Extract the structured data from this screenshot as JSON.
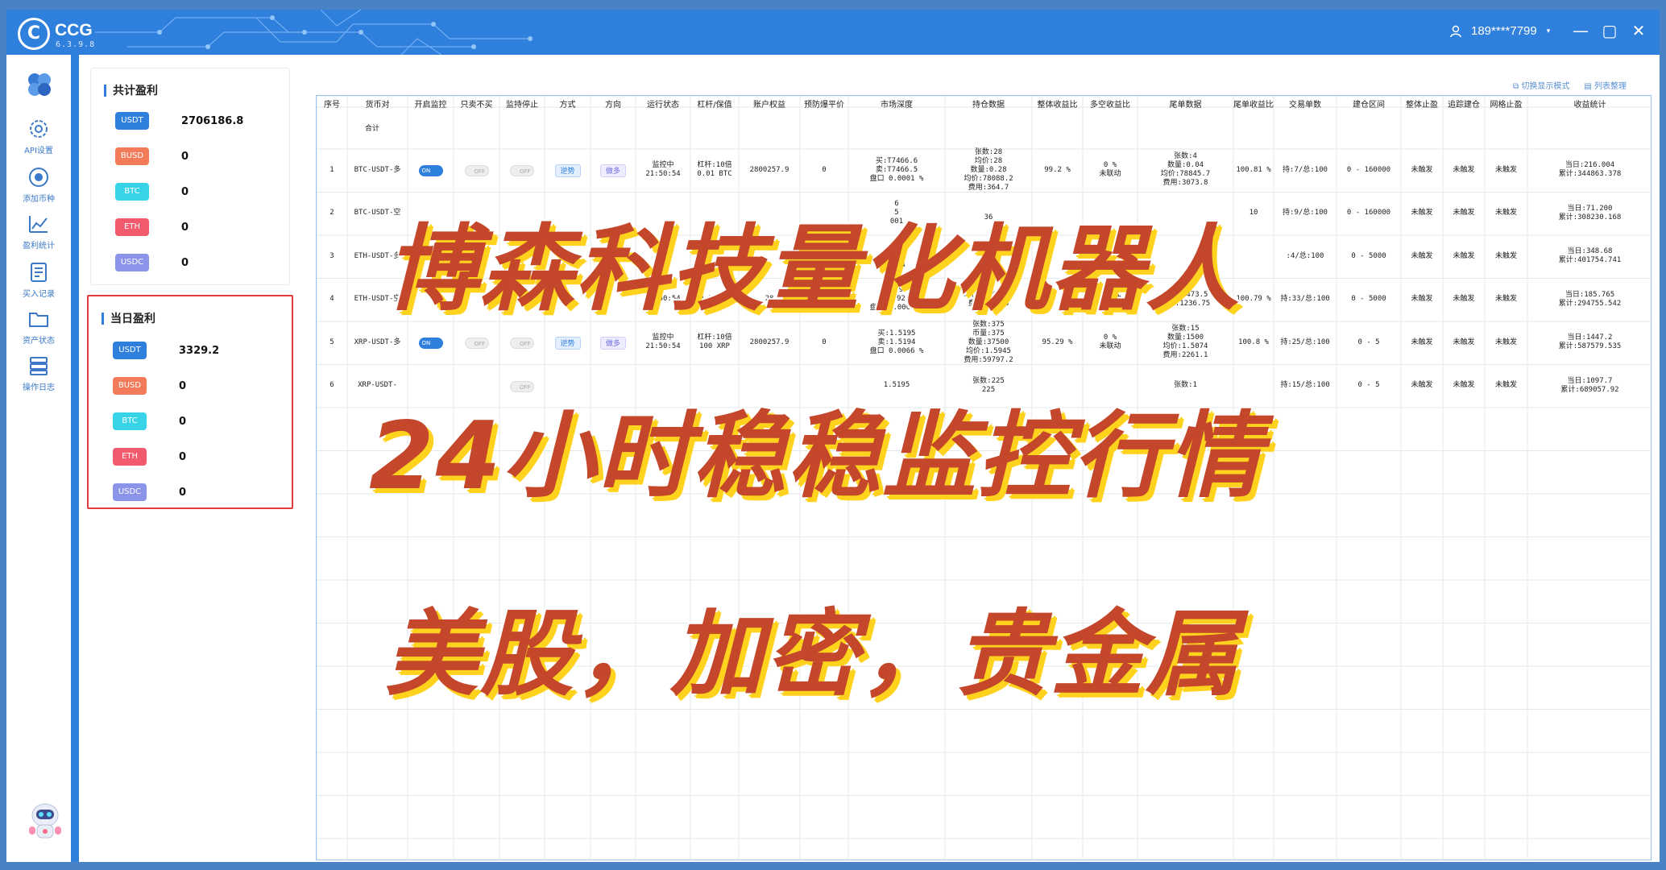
{
  "app": {
    "name": "CCG",
    "version": "6.3.9.8",
    "logo_letter": "C"
  },
  "user": {
    "phone": "189****7799"
  },
  "window_controls": {
    "minimize": "—",
    "restore": "▢",
    "close": "✕"
  },
  "sidebar": [
    {
      "label": "API设置",
      "icon": "gear-icon"
    },
    {
      "label": "添加币种",
      "icon": "target-icon"
    },
    {
      "label": "盈利统计",
      "icon": "chart-icon"
    },
    {
      "label": "买入记录",
      "icon": "receipt-icon"
    },
    {
      "label": "资产状态",
      "icon": "folder-icon"
    },
    {
      "label": "操作日志",
      "icon": "log-icon"
    }
  ],
  "summary_total": {
    "title": "共计盈利",
    "rows": [
      {
        "coin": "USDT",
        "value": "2706186.8",
        "color": "#2f7fdc"
      },
      {
        "coin": "BUSD",
        "value": "0",
        "color": "#f27c5a"
      },
      {
        "coin": "BTC",
        "value": "0",
        "color": "#38d3e6"
      },
      {
        "coin": "ETH",
        "value": "0",
        "color": "#f25a6e"
      },
      {
        "coin": "USDC",
        "value": "0",
        "color": "#8c94ea"
      }
    ]
  },
  "summary_today": {
    "title": "当日盈利",
    "rows": [
      {
        "coin": "USDT",
        "value": "3329.2",
        "color": "#2f7fdc"
      },
      {
        "coin": "BUSD",
        "value": "0",
        "color": "#f27c5a"
      },
      {
        "coin": "BTC",
        "value": "0",
        "color": "#38d3e6"
      },
      {
        "coin": "ETH",
        "value": "0",
        "color": "#f25a6e"
      },
      {
        "coin": "USDC",
        "value": "0",
        "color": "#8c94ea"
      }
    ]
  },
  "toolbar": {
    "switch_view": "切换显示模式",
    "list_settings": "列表整理"
  },
  "table": {
    "headers": [
      "序号",
      "货币对",
      "开启监控",
      "只卖不买",
      "监持停止",
      "方式",
      "方向",
      "运行状态",
      "杠杆/保值",
      "账户权益",
      "预防爆平价",
      "市场深度",
      "持仓数据",
      "整体收益比",
      "多空收益比",
      "尾单数据",
      "尾单收益比",
      "交易单数",
      "建仓区间",
      "整体止盈",
      "追踪建仓",
      "网格止盈",
      "收益统计"
    ],
    "total_label": "合计",
    "rows": [
      {
        "idx": "1",
        "pair": "BTC-USDT-多",
        "monitor": "ON",
        "sell_only": "OFF",
        "stop": "OFF",
        "mode": "逆势",
        "dir": "做多",
        "status": "监控中\n21:50:54",
        "lev": "杠杆:10倍\n0.01 BTC",
        "equity": "2800257.9",
        "liq": "0",
        "depth": "买:T7466.6\n卖:T7466.5\n盘口 0.0001 %",
        "pos": "张数:28\n均价:28\n数量:0.28\n均价:78088.2\n费用:364.7",
        "ratio": "99.2 %",
        "ls": "0 %\n未联动",
        "tail": "张数:4\n数量:0.04\n均价:78845.7\n费用:3073.8",
        "tail_ratio": "100.81 %",
        "trades": "持:7/总:100",
        "range": "0 - 160000",
        "tp": "未触发",
        "trail": "未触发",
        "grid": "未触发",
        "stat": "当日:216.004\n累计:344863.378"
      },
      {
        "idx": "2",
        "pair": "BTC-USDT-空",
        "monitor": "",
        "sell_only": "",
        "stop": "",
        "mode": "",
        "dir": "",
        "status": "",
        "lev": "",
        "equity": "",
        "liq": "",
        "depth": "6\n5\n001",
        "pos": "\n36",
        "ratio": "",
        "ls": "",
        "tail": "",
        "tail_ratio": "10",
        "trades": "持:9/总:100",
        "range": "0 - 160000",
        "tp": "未触发",
        "trail": "未触发",
        "grid": "未触发",
        "stat": "当日:71.200\n累计:308230.168"
      },
      {
        "idx": "3",
        "pair": "ETH-USDT-多",
        "monitor": "",
        "sell_only": "",
        "stop": "",
        "mode": "",
        "dir": "",
        "status": "",
        "lev": "",
        "equity": "",
        "liq": "",
        "depth": "3.9\n3.92\n0004",
        "pos": "3.2",
        "ratio": "",
        "ls": "",
        "tail": "",
        "tail_ratio": "",
        "trades": ":4/总:100",
        "range": "0 - 5000",
        "tp": "未触发",
        "trail": "未触发",
        "grid": "未触发",
        "stat": "当日:348.68\n累计:401754.741"
      },
      {
        "idx": "4",
        "pair": "ETH-USDT-空",
        "monitor": "",
        "sell_only": "",
        "stop": "",
        "mode": "",
        "dir": "",
        "status": "21:50:54",
        "lev": "0.1 ETH",
        "equity": "28",
        "liq": "",
        "depth": "3.9\n3.92\n盘口 0.0004 %",
        "pos": "均价:2344.72\n费用:38688",
        "ratio": "",
        "ls": "未联动",
        "tail": "均价:2473.5\n费用:1236.75",
        "tail_ratio": "100.79 %",
        "trades": "持:33/总:100",
        "range": "0 - 5000",
        "tp": "未触发",
        "trail": "未触发",
        "grid": "未触发",
        "stat": "当日:185.765\n累计:294755.542"
      },
      {
        "idx": "5",
        "pair": "XRP-USDT-多",
        "monitor": "ON",
        "sell_only": "OFF",
        "stop": "OFF",
        "mode": "逆势",
        "dir": "做多",
        "status": "监控中\n21:50:54",
        "lev": "杠杆:10倍\n100 XRP",
        "equity": "2800257.9",
        "liq": "0",
        "depth": "买:1.5195\n卖:1.5194\n盘口 0.0066 %",
        "pos": "张数:375\n币量:375\n数量:37500\n均价:1.5945\n费用:59797.2",
        "ratio": "95.29 %",
        "ls": "0 %\n未联动",
        "tail": "张数:15\n数量:1500\n均价:1.5074\n费用:2261.1",
        "tail_ratio": "100.8 %",
        "trades": "持:25/总:100",
        "range": "0 - 5",
        "tp": "未触发",
        "trail": "未触发",
        "grid": "未触发",
        "stat": "当日:1447.2\n累计:587579.535"
      },
      {
        "idx": "6",
        "pair": "XRP-USDT-",
        "monitor": "",
        "sell_only": "",
        "stop": "OFF",
        "mode": "",
        "dir": "",
        "status": "",
        "lev": "",
        "equity": "",
        "liq": "",
        "depth": "1.5195",
        "pos": "张数:225\n225",
        "ratio": "",
        "ls": "",
        "tail": "张数:1",
        "tail_ratio": "",
        "trades": "持:15/总:100",
        "range": "0 - 5",
        "tp": "未触发",
        "trail": "未触发",
        "grid": "未触发",
        "stat": "当日:1097.7\n累计:689057.92"
      }
    ]
  },
  "promo": {
    "line1": "博森科技量化机器人",
    "line2": "24小时稳稳监控行情",
    "line3": "美股，加密，贵金属"
  }
}
